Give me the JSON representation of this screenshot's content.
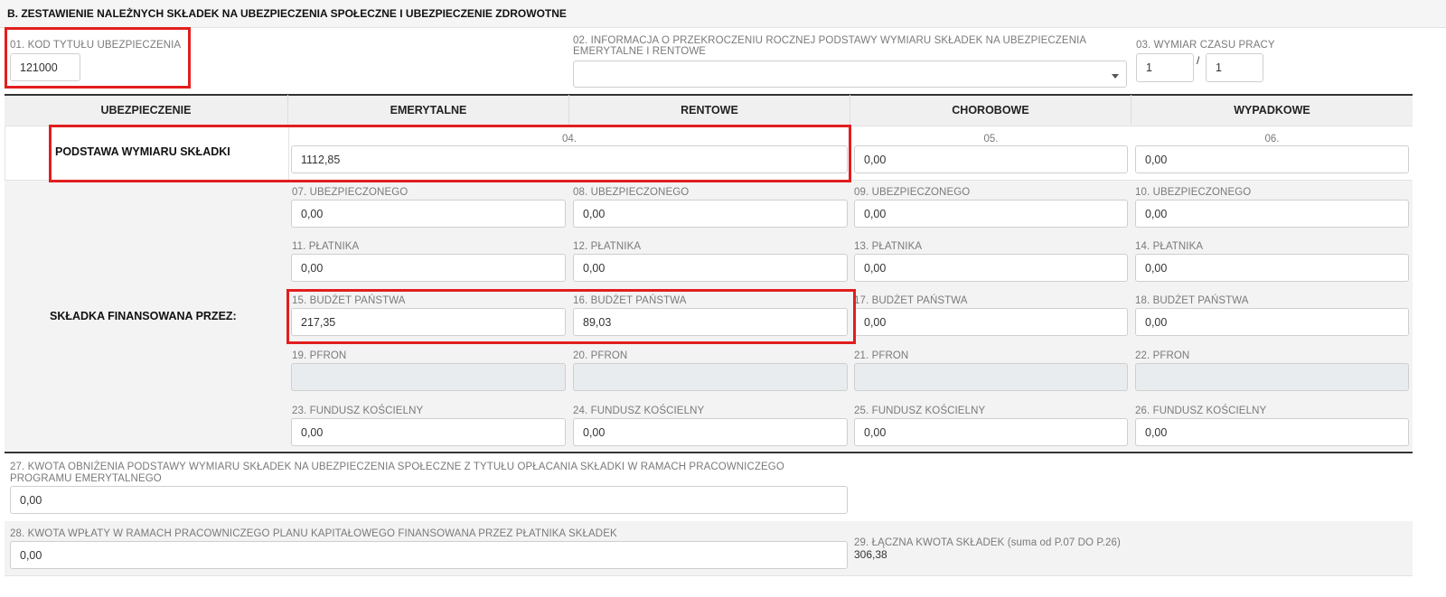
{
  "section_title": "B. ZESTAWIENIE NALEŻNYCH SKŁADEK NA UBEZPIECZENIA SPOŁECZNE I UBEZPIECZENIE ZDROWOTNE",
  "top": {
    "f01_label": "01. KOD TYTUŁU UBEZPIECZENIA",
    "f01_value": "121000",
    "f02_label": "02. INFORMACJA O PRZEKROCZENIU ROCZNEJ PODSTAWY WYMIARU SKŁADEK NA UBEZPIECZENIA EMERYTALNE I RENTOWE",
    "f02_value": "",
    "f03_label": "03. WYMIAR CZASU PRACY",
    "f03_num": "1",
    "f03_sep": "/",
    "f03_den": "1"
  },
  "headers": [
    "UBEZPIECZENIE",
    "EMERYTALNE",
    "RENTOWE",
    "CHOROBOWE",
    "WYPADKOWE"
  ],
  "podstawa": {
    "label": "PODSTAWA WYMIARU SKŁADKI",
    "f04_num": "04.",
    "f04_value": "1112,85",
    "f05_num": "05.",
    "f05_value": "0,00",
    "f06_num": "06.",
    "f06_value": "0,00"
  },
  "skladka": {
    "label": "SKŁADKA FINANSOWANA PRZEZ:",
    "rows": [
      {
        "cells": [
          {
            "label": "07. UBEZPIECZONEGO",
            "value": "0,00"
          },
          {
            "label": "08. UBEZPIECZONEGO",
            "value": "0,00"
          },
          {
            "label": "09. UBEZPIECZONEGO",
            "value": "0,00"
          },
          {
            "label": "10. UBEZPIECZONEGO",
            "value": "0,00"
          }
        ]
      },
      {
        "cells": [
          {
            "label": "11. PŁATNIKA",
            "value": "0,00"
          },
          {
            "label": "12. PŁATNIKA",
            "value": "0,00"
          },
          {
            "label": "13. PŁATNIKA",
            "value": "0,00"
          },
          {
            "label": "14. PŁATNIKA",
            "value": "0,00"
          }
        ]
      },
      {
        "cells": [
          {
            "label": "15. BUDŻET PAŃSTWA",
            "value": "217,35"
          },
          {
            "label": "16. BUDŻET PAŃSTWA",
            "value": "89,03"
          },
          {
            "label": "17. BUDŻET PAŃSTWA",
            "value": "0,00"
          },
          {
            "label": "18. BUDŻET PAŃSTWA",
            "value": "0,00"
          }
        ]
      },
      {
        "cells": [
          {
            "label": "19. PFRON",
            "value": ""
          },
          {
            "label": "20. PFRON",
            "value": ""
          },
          {
            "label": "21. PFRON",
            "value": ""
          },
          {
            "label": "22. PFRON",
            "value": ""
          }
        ]
      },
      {
        "cells": [
          {
            "label": "23. FUNDUSZ KOŚCIELNY",
            "value": "0,00"
          },
          {
            "label": "24. FUNDUSZ KOŚCIELNY",
            "value": "0,00"
          },
          {
            "label": "25. FUNDUSZ KOŚCIELNY",
            "value": "0,00"
          },
          {
            "label": "26. FUNDUSZ KOŚCIELNY",
            "value": "0,00"
          }
        ]
      }
    ]
  },
  "bottom": {
    "f27_label_line1": "27. KWOTA OBNIŻENIA PODSTAWY WYMIARU SKŁADEK NA UBEZPIECZENIA SPOŁECZNE Z TYTUŁU OPŁACANIA SKŁADKI W RAMACH PRACOWNICZEGO",
    "f27_label_line2": "PROGRAMU EMERYTALNEGO",
    "f27_value": "0,00",
    "f28_label": "28. KWOTA WPŁATY W RAMACH PRACOWNICZEGO PLANU KAPITAŁOWEGO FINANSOWANA PRZEZ PŁATNIKA SKŁADEK",
    "f28_value": "0,00",
    "f29_label": "29. ŁĄCZNA KWOTA SKŁADEK (suma od P.07 DO P.26)",
    "f29_value": "306,38"
  },
  "colors": {
    "highlight": "#e21e1e",
    "panel": "#f2f2f2",
    "disabled": "#e9ecef"
  }
}
